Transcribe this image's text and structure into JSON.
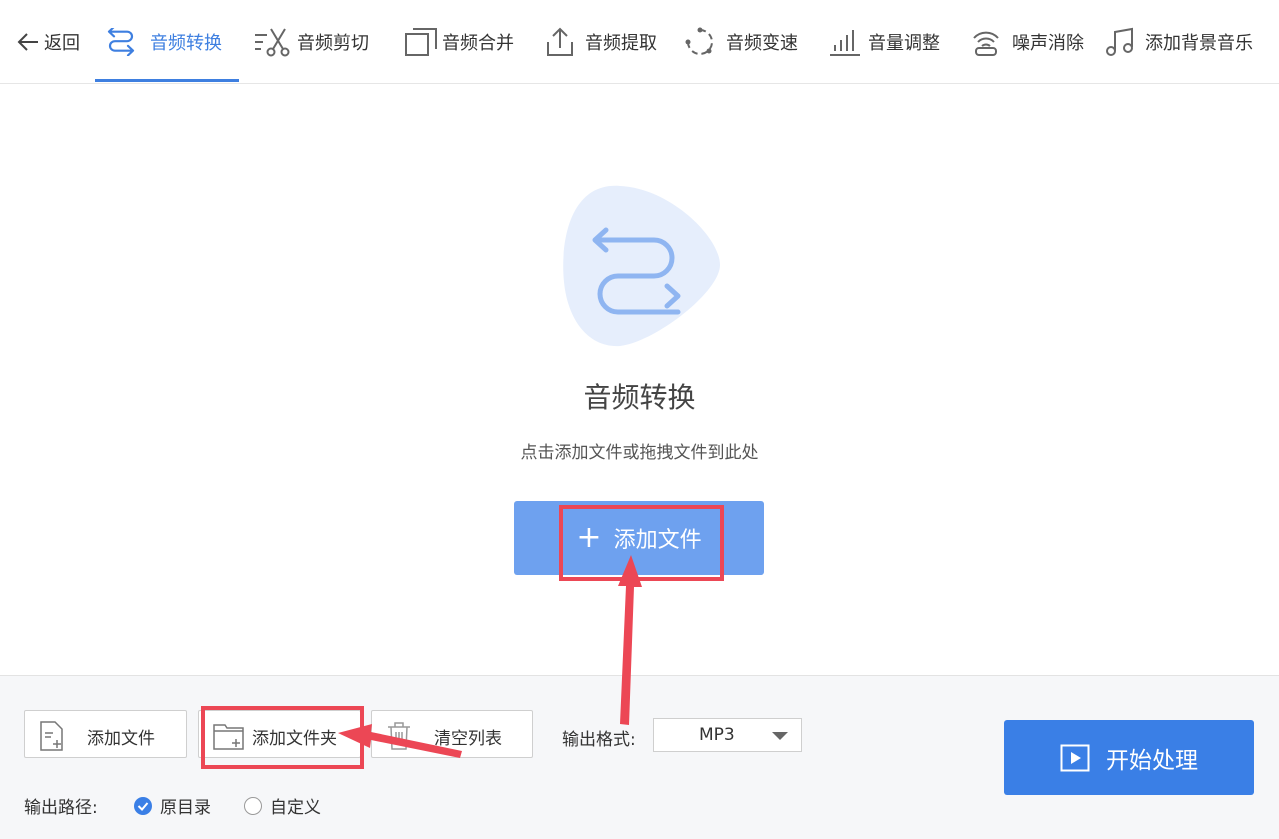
{
  "nav": {
    "back_label": "返回",
    "items": [
      {
        "label": "音频转换",
        "icon": "convert-arrows-icon",
        "active": true
      },
      {
        "label": "音频剪切",
        "icon": "scissors-icon"
      },
      {
        "label": "音频合并",
        "icon": "merge-icon"
      },
      {
        "label": "音频提取",
        "icon": "upload-extract-icon"
      },
      {
        "label": "音频变速",
        "icon": "speed-icon"
      },
      {
        "label": "音量调整",
        "icon": "volume-bars-icon"
      },
      {
        "label": "噪声消除",
        "icon": "noise-icon"
      },
      {
        "label": "添加背景音乐",
        "icon": "music-note-icon"
      }
    ]
  },
  "main": {
    "title": "音频转换",
    "hint": "点击添加文件或拖拽文件到此处",
    "add_file_label": "添加文件"
  },
  "toolbar": {
    "add_file_label": "添加文件",
    "add_folder_label": "添加文件夹",
    "clear_list_label": "清空列表",
    "output_format_label": "输出格式:",
    "output_format_value": "MP3",
    "start_label": "开始处理"
  },
  "output_path": {
    "label": "输出路径:",
    "options": [
      {
        "label": "原目录",
        "selected": true
      },
      {
        "label": "自定义",
        "selected": false
      }
    ]
  },
  "colors": {
    "accent": "#3e7fe0",
    "primary_button": "#3a7fe6",
    "drop_button": "#6ea1ef",
    "annotation": "#ec4755"
  }
}
